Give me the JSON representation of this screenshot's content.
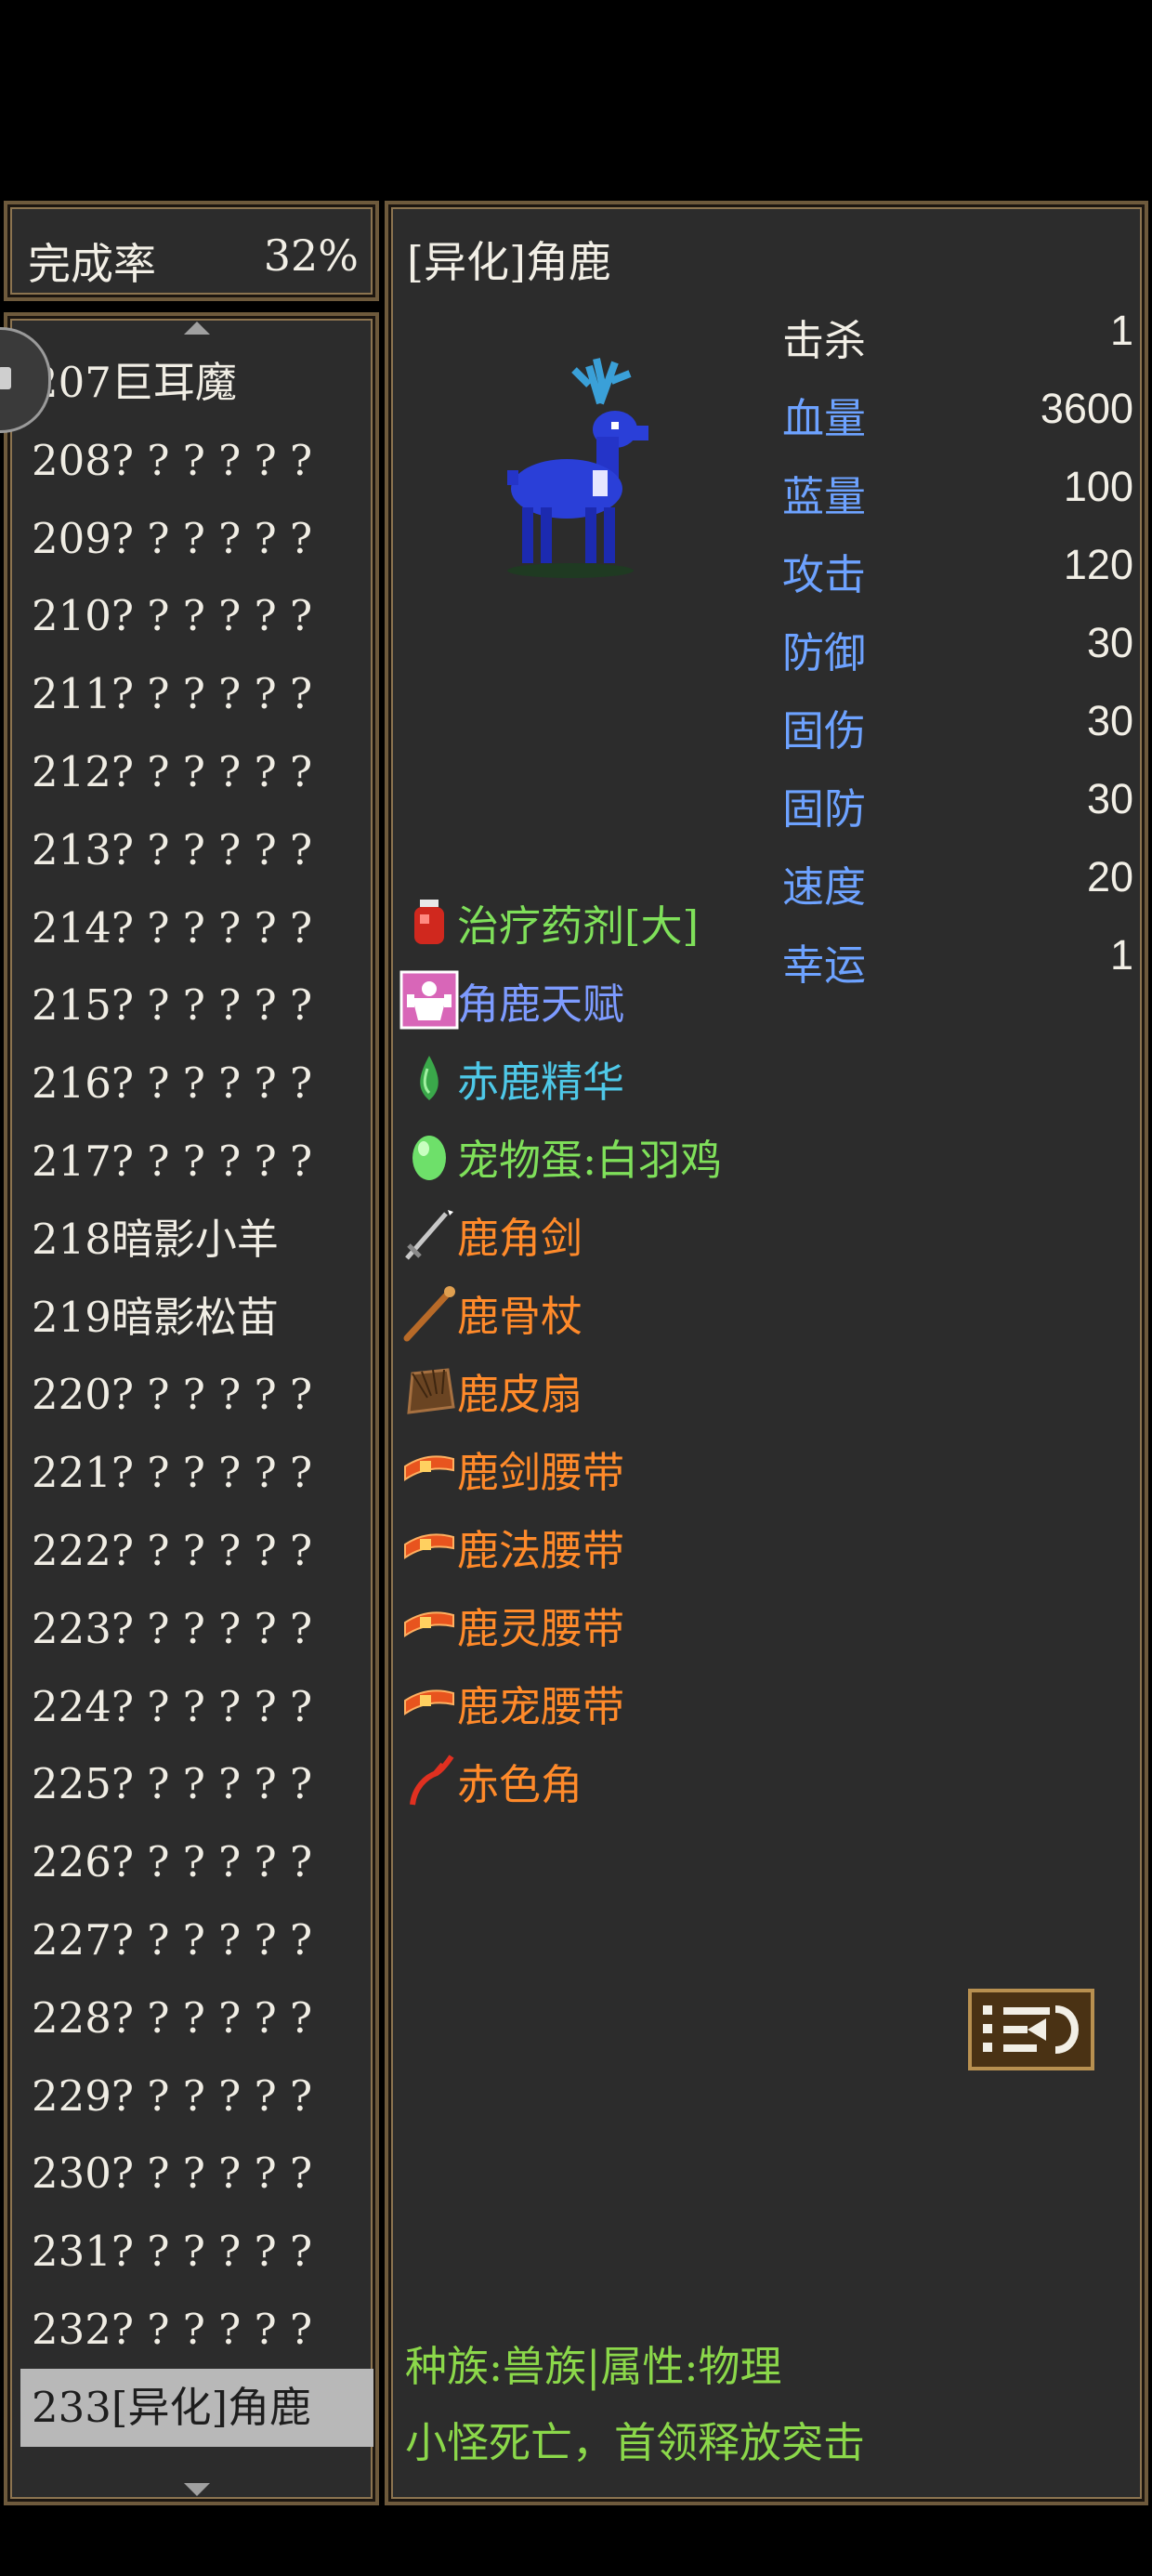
{
  "completion": {
    "label": "完成率",
    "value": "32%"
  },
  "monster_list": [
    {
      "label": "207巨耳魔",
      "selected": false
    },
    {
      "label": "208? ? ? ? ? ?",
      "selected": false
    },
    {
      "label": "209? ? ? ? ? ?",
      "selected": false
    },
    {
      "label": "210? ? ? ? ? ?",
      "selected": false
    },
    {
      "label": "211? ? ? ? ? ?",
      "selected": false
    },
    {
      "label": "212? ? ? ? ? ?",
      "selected": false
    },
    {
      "label": "213? ? ? ? ? ?",
      "selected": false
    },
    {
      "label": "214? ? ? ? ? ?",
      "selected": false
    },
    {
      "label": "215? ? ? ? ? ?",
      "selected": false
    },
    {
      "label": "216? ? ? ? ? ?",
      "selected": false
    },
    {
      "label": "217? ? ? ? ? ?",
      "selected": false
    },
    {
      "label": "218暗影小羊",
      "selected": false
    },
    {
      "label": "219暗影松苗",
      "selected": false
    },
    {
      "label": "220? ? ? ? ? ?",
      "selected": false
    },
    {
      "label": "221? ? ? ? ? ?",
      "selected": false
    },
    {
      "label": "222? ? ? ? ? ?",
      "selected": false
    },
    {
      "label": "223? ? ? ? ? ?",
      "selected": false
    },
    {
      "label": "224? ? ? ? ? ?",
      "selected": false
    },
    {
      "label": "225? ? ? ? ? ?",
      "selected": false
    },
    {
      "label": "226? ? ? ? ? ?",
      "selected": false
    },
    {
      "label": "227? ? ? ? ? ?",
      "selected": false
    },
    {
      "label": "228? ? ? ? ? ?",
      "selected": false
    },
    {
      "label": "229? ? ? ? ? ?",
      "selected": false
    },
    {
      "label": "230? ? ? ? ? ?",
      "selected": false
    },
    {
      "label": "231? ? ? ? ? ?",
      "selected": false
    },
    {
      "label": "232? ? ? ? ? ?",
      "selected": false
    },
    {
      "label": "233[异化]角鹿",
      "selected": true
    }
  ],
  "detail": {
    "name": "[异化]角鹿",
    "stats": [
      {
        "label": "击杀",
        "value": "1"
      },
      {
        "label": "血量",
        "value": "3600"
      },
      {
        "label": "蓝量",
        "value": "100"
      },
      {
        "label": "攻击",
        "value": "120"
      },
      {
        "label": "防御",
        "value": "30"
      },
      {
        "label": "固伤",
        "value": "30"
      },
      {
        "label": "固防",
        "value": "30"
      },
      {
        "label": "速度",
        "value": "20"
      },
      {
        "label": "幸运",
        "value": "1"
      }
    ],
    "drops": [
      {
        "name": "治疗药剂[大]",
        "color": "#7fe05a",
        "icon": "potion-icon"
      },
      {
        "name": "角鹿天赋",
        "color": "#7d9bff",
        "icon": "talent-icon"
      },
      {
        "name": "赤鹿精华",
        "color": "#4ec8e8",
        "icon": "essence-icon"
      },
      {
        "name": "宠物蛋:白羽鸡",
        "color": "#7fe05a",
        "icon": "egg-icon"
      },
      {
        "name": "鹿角剑",
        "color": "#ff8a2a",
        "icon": "sword-icon"
      },
      {
        "name": "鹿骨杖",
        "color": "#ff8a2a",
        "icon": "staff-icon"
      },
      {
        "name": "鹿皮扇",
        "color": "#ff8a2a",
        "icon": "fan-icon"
      },
      {
        "name": "鹿剑腰带",
        "color": "#ff8a2a",
        "icon": "belt-icon"
      },
      {
        "name": "鹿法腰带",
        "color": "#ff8a2a",
        "icon": "belt-icon"
      },
      {
        "name": "鹿灵腰带",
        "color": "#ff8a2a",
        "icon": "belt-icon"
      },
      {
        "name": "鹿宠腰带",
        "color": "#ff8a2a",
        "icon": "belt-icon"
      },
      {
        "name": "赤色角",
        "color": "#ff8a2a",
        "icon": "horn-icon"
      }
    ],
    "race": "种族:兽族|属性:物理",
    "skill": "小怪死亡，首领释放突击"
  },
  "colors": {
    "panel_bg": "#2c2c2c",
    "border": "#6e5a3c",
    "stat_label": "#6da2ff",
    "race_text": "#8bd84a"
  }
}
